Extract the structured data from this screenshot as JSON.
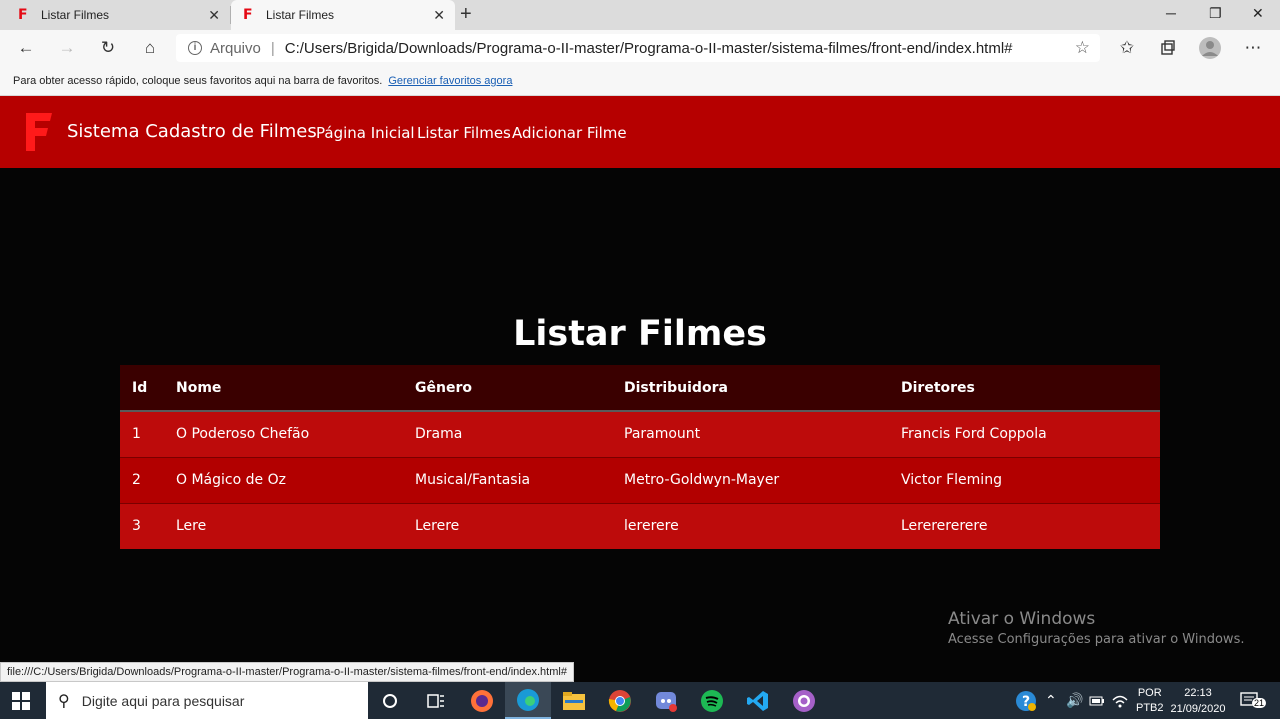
{
  "browser": {
    "tabs": [
      {
        "title": "Listar Filmes",
        "active": false
      },
      {
        "title": "Listar Filmes",
        "active": true
      }
    ],
    "address": {
      "protocol_label": "Arquivo",
      "url": "C:/Users/Brigida/Downloads/Programa-o-II-master/Programa-o-II-master/sistema-filmes/front-end/index.html#"
    },
    "favorites_bar": {
      "message": "Para obter acesso rápido, coloque seus favoritos aqui na barra de favoritos.",
      "link": "Gerenciar favoritos agora"
    },
    "status_url": "file:///C:/Users/Brigida/Downloads/Programa-o-II-master/Programa-o-II-master/sistema-filmes/front-end/index.html#"
  },
  "page": {
    "brand": "Sistema Cadastro de Filmes",
    "nav": [
      "Página Inicial",
      "Listar Filmes",
      "Adicionar Filme"
    ],
    "title": "Listar Filmes",
    "table": {
      "headers": [
        "Id",
        "Nome",
        "Gênero",
        "Distribuidora",
        "Diretores"
      ],
      "rows": [
        [
          "1",
          "O Poderoso Chefão",
          "Drama",
          "Paramount",
          "Francis Ford Coppola"
        ],
        [
          "2",
          "O Mágico de Oz",
          "Musical/Fantasia",
          "Metro-Goldwyn-Mayer",
          "Victor Fleming"
        ],
        [
          "3",
          "Lere",
          "Lerere",
          "lererere",
          "Lererererere"
        ]
      ]
    },
    "colors": {
      "navbar": "#b60000",
      "header_row": "#3a0000",
      "row": "#bd0b0b",
      "background": "#050505"
    }
  },
  "watermark": {
    "line1": "Ativar o Windows",
    "line2": "Acesse Configurações para ativar o Windows."
  },
  "taskbar": {
    "search_placeholder": "Digite aqui para pesquisar",
    "apps": [
      "cortana-icon",
      "task-view-icon",
      "firefox-icon",
      "edge-icon",
      "file-explorer-icon",
      "chrome-icon",
      "discord-icon",
      "spotify-icon",
      "vscode-icon",
      "app-icon"
    ],
    "lang": "POR",
    "layout": "PTB2",
    "time": "22:13",
    "date": "21/09/2020",
    "notifications": "21"
  }
}
